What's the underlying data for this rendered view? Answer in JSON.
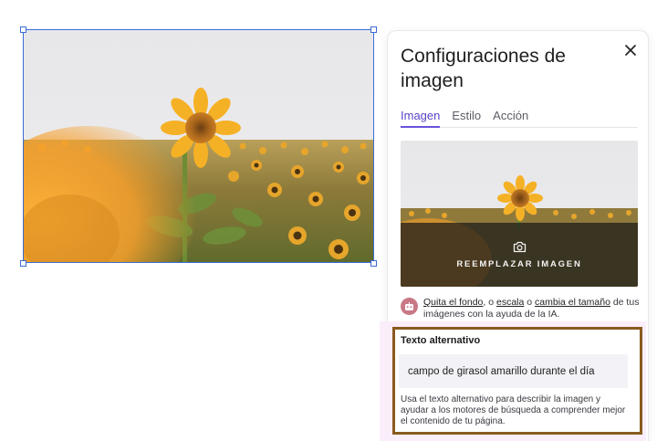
{
  "panel": {
    "title": "Configuraciones de imagen",
    "close_icon": "close-icon",
    "tabs": [
      {
        "label": "Imagen",
        "active": true
      },
      {
        "label": "Estilo",
        "active": false
      },
      {
        "label": "Acción",
        "active": false
      }
    ],
    "replace": {
      "icon": "camera-icon",
      "label": "REEMPLAZAR IMAGEN"
    },
    "ai_hint": {
      "icon": "robot-icon",
      "link_background": "Quita el fondo",
      "sep1": ", o ",
      "link_scale": "escala",
      "sep2": " o ",
      "link_resize": "cambia el tamaño",
      "suffix": " de tus imágenes con la ayuda de la IA."
    },
    "alt_text": {
      "heading": "Texto alternativo",
      "value": "campo de girasol amarillo durante el día",
      "help": "Usa el texto alternativo para describir la imagen y ayudar a los motores de búsqueda a comprender mejor el contenido de tu página."
    }
  },
  "colors": {
    "accent": "#6a52dc",
    "selection": "#3b6cd6",
    "highlight_border": "#8a5a1e",
    "highlight_glow": "#fbeefb"
  }
}
